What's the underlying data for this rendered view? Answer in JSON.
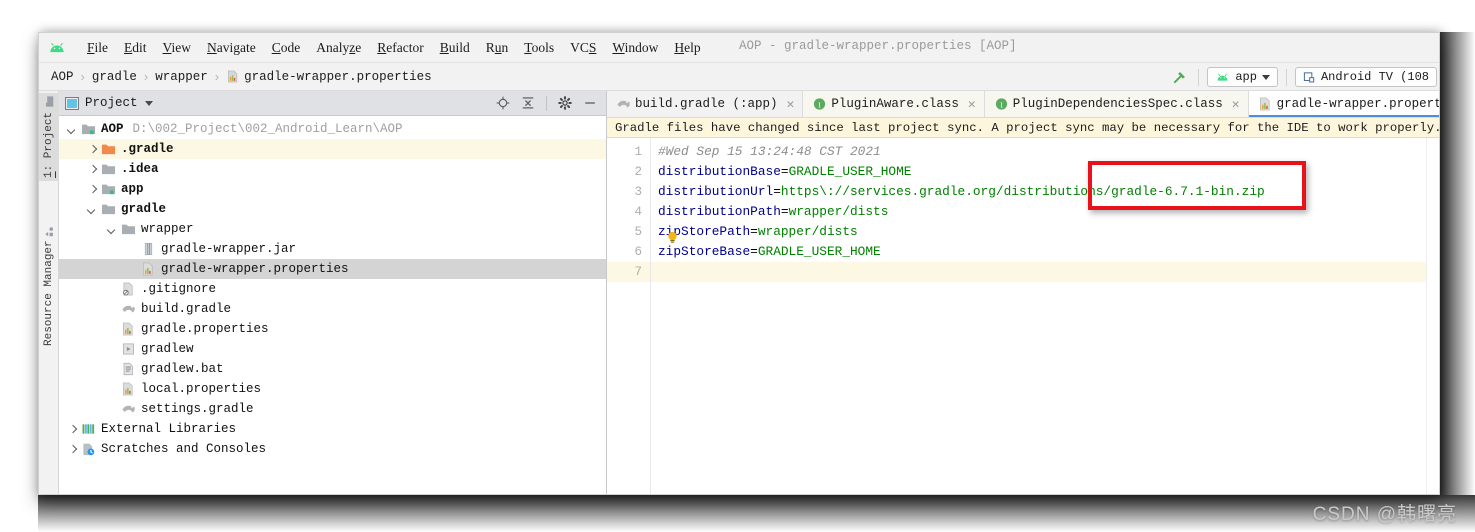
{
  "window": {
    "title": "AOP - gradle-wrapper.properties [AOP]",
    "logo_icon": "android-logo-icon"
  },
  "menubar": {
    "items": [
      {
        "label": "File",
        "mnemonic": "F"
      },
      {
        "label": "Edit",
        "mnemonic": "E"
      },
      {
        "label": "View",
        "mnemonic": "V"
      },
      {
        "label": "Navigate",
        "mnemonic": "N"
      },
      {
        "label": "Code",
        "mnemonic": "C"
      },
      {
        "label": "Analyze",
        "mnemonic": "z"
      },
      {
        "label": "Refactor",
        "mnemonic": "R"
      },
      {
        "label": "Build",
        "mnemonic": "B"
      },
      {
        "label": "Run",
        "mnemonic": "u"
      },
      {
        "label": "Tools",
        "mnemonic": "T"
      },
      {
        "label": "VCS",
        "mnemonic": "S"
      },
      {
        "label": "Window",
        "mnemonic": "W"
      },
      {
        "label": "Help",
        "mnemonic": "H"
      }
    ]
  },
  "navbar": {
    "breadcrumbs": [
      "AOP",
      "gradle",
      "wrapper",
      "gradle-wrapper.properties"
    ],
    "separator": "›",
    "build_icon": "hammer-icon",
    "run_config": "app",
    "device": "Android TV (108"
  },
  "project_panel": {
    "title": "Project",
    "header_icons": [
      "locate-icon",
      "collapse-all-icon",
      "settings-gear-icon",
      "minimize-icon"
    ],
    "tree": [
      {
        "depth": 0,
        "arrow": "open",
        "icon": "module-folder-icon",
        "name": "AOP",
        "bold": true,
        "path": "D:\\002_Project\\002_Android_Learn\\AOP",
        "state": "none"
      },
      {
        "depth": 1,
        "arrow": "closed",
        "icon": "folder-orange-icon",
        "name": ".gradle",
        "bold": true,
        "path": "",
        "state": "highlight"
      },
      {
        "depth": 1,
        "arrow": "closed",
        "icon": "folder-icon",
        "name": ".idea",
        "bold": true,
        "path": "",
        "state": "none"
      },
      {
        "depth": 1,
        "arrow": "closed",
        "icon": "module-folder-icon",
        "name": "app",
        "bold": true,
        "path": "",
        "state": "none"
      },
      {
        "depth": 1,
        "arrow": "open",
        "icon": "folder-icon",
        "name": "gradle",
        "bold": true,
        "path": "",
        "state": "none"
      },
      {
        "depth": 2,
        "arrow": "open",
        "icon": "folder-icon",
        "name": "wrapper",
        "bold": false,
        "path": "",
        "state": "none"
      },
      {
        "depth": 3,
        "arrow": "none",
        "icon": "jar-file-icon",
        "name": "gradle-wrapper.jar",
        "bold": false,
        "path": "",
        "state": "none"
      },
      {
        "depth": 3,
        "arrow": "none",
        "icon": "properties-file-icon",
        "name": "gradle-wrapper.properties",
        "bold": false,
        "path": "",
        "state": "selected"
      },
      {
        "depth": 2,
        "arrow": "none",
        "icon": "gitignore-file-icon",
        "name": ".gitignore",
        "bold": false,
        "path": "",
        "state": "none"
      },
      {
        "depth": 2,
        "arrow": "none",
        "icon": "gradle-file-icon",
        "name": "build.gradle",
        "bold": false,
        "path": "",
        "state": "none"
      },
      {
        "depth": 2,
        "arrow": "none",
        "icon": "properties-file-icon",
        "name": "gradle.properties",
        "bold": false,
        "path": "",
        "state": "none"
      },
      {
        "depth": 2,
        "arrow": "none",
        "icon": "script-file-icon",
        "name": "gradlew",
        "bold": false,
        "path": "",
        "state": "none"
      },
      {
        "depth": 2,
        "arrow": "none",
        "icon": "bat-file-icon",
        "name": "gradlew.bat",
        "bold": false,
        "path": "",
        "state": "none"
      },
      {
        "depth": 2,
        "arrow": "none",
        "icon": "properties-file-icon",
        "name": "local.properties",
        "bold": false,
        "path": "",
        "state": "none"
      },
      {
        "depth": 2,
        "arrow": "none",
        "icon": "gradle-file-icon",
        "name": "settings.gradle",
        "bold": false,
        "path": "",
        "state": "none"
      },
      {
        "depth": 0,
        "arrow": "closed",
        "icon": "libraries-icon",
        "name": "External Libraries",
        "bold": false,
        "path": "",
        "state": "none"
      },
      {
        "depth": 0,
        "arrow": "closed",
        "icon": "scratches-icon",
        "name": "Scratches and Consoles",
        "bold": false,
        "path": "",
        "state": "none"
      }
    ]
  },
  "toolstrip": {
    "items": [
      {
        "label": "1: Project",
        "mnemonic": "1",
        "icon": "project-icon",
        "selected": true
      },
      {
        "label": "Resource Manager",
        "mnemonic": "",
        "icon": "resource-manager-icon",
        "selected": false
      }
    ]
  },
  "editor": {
    "tabs": [
      {
        "label": "build.gradle (:app)",
        "icon": "gradle-file-icon",
        "active": false,
        "closable": true
      },
      {
        "label": "PluginAware.class",
        "icon": "interface-class-icon",
        "active": false,
        "closable": true
      },
      {
        "label": "PluginDependenciesSpec.class",
        "icon": "interface-class-icon",
        "active": false,
        "closable": true
      },
      {
        "label": "gradle-wrapper.properties",
        "icon": "properties-file-icon",
        "active": true,
        "closable": true
      }
    ],
    "notification": "Gradle files have changed since last project sync. A project sync may be necessary for the IDE to work properly.",
    "lines": [
      {
        "num": "1",
        "current": false,
        "parts": [
          {
            "t": "#Wed Sep 15 13:24:48 CST 2021",
            "c": "cm"
          }
        ]
      },
      {
        "num": "2",
        "current": false,
        "parts": [
          {
            "t": "distributionBase",
            "c": "k"
          },
          {
            "t": "=",
            "c": "eq"
          },
          {
            "t": "GRADLE_USER_HOME",
            "c": "v"
          }
        ]
      },
      {
        "num": "3",
        "current": false,
        "parts": [
          {
            "t": "distributionUrl",
            "c": "k"
          },
          {
            "t": "=",
            "c": "eq"
          },
          {
            "t": "https\\://services.gradle.org/distributions/gradle-6.7.1-bin.zip",
            "c": "v"
          }
        ]
      },
      {
        "num": "4",
        "current": false,
        "parts": [
          {
            "t": "distributionPath",
            "c": "k"
          },
          {
            "t": "=",
            "c": "eq"
          },
          {
            "t": "wrapper/dists",
            "c": "v"
          }
        ]
      },
      {
        "num": "5",
        "current": false,
        "parts": [
          {
            "t": "zipStorePath",
            "c": "k"
          },
          {
            "t": "=",
            "c": "eq"
          },
          {
            "t": "wrapper/dists",
            "c": "v"
          }
        ]
      },
      {
        "num": "6",
        "current": false,
        "parts": [
          {
            "t": "zipStoreBase",
            "c": "k"
          },
          {
            "t": "=",
            "c": "eq"
          },
          {
            "t": "GRADLE_USER_HOME",
            "c": "v"
          }
        ]
      },
      {
        "num": "7",
        "current": true,
        "parts": [
          {
            "t": "",
            "c": "eq"
          }
        ]
      }
    ],
    "intention_icon": "lightbulb-icon",
    "annotation": {
      "type": "red-rectangle",
      "color": "#e8131a"
    }
  },
  "watermark": "CSDN @韩曙亮",
  "colors": {
    "accent": "#4a90d9",
    "annotation_red": "#e8131a",
    "notify_bg": "#fdf6dc",
    "key_blue": "#00008b",
    "value_green": "#008000",
    "comment_gray": "#8c8c8c"
  }
}
